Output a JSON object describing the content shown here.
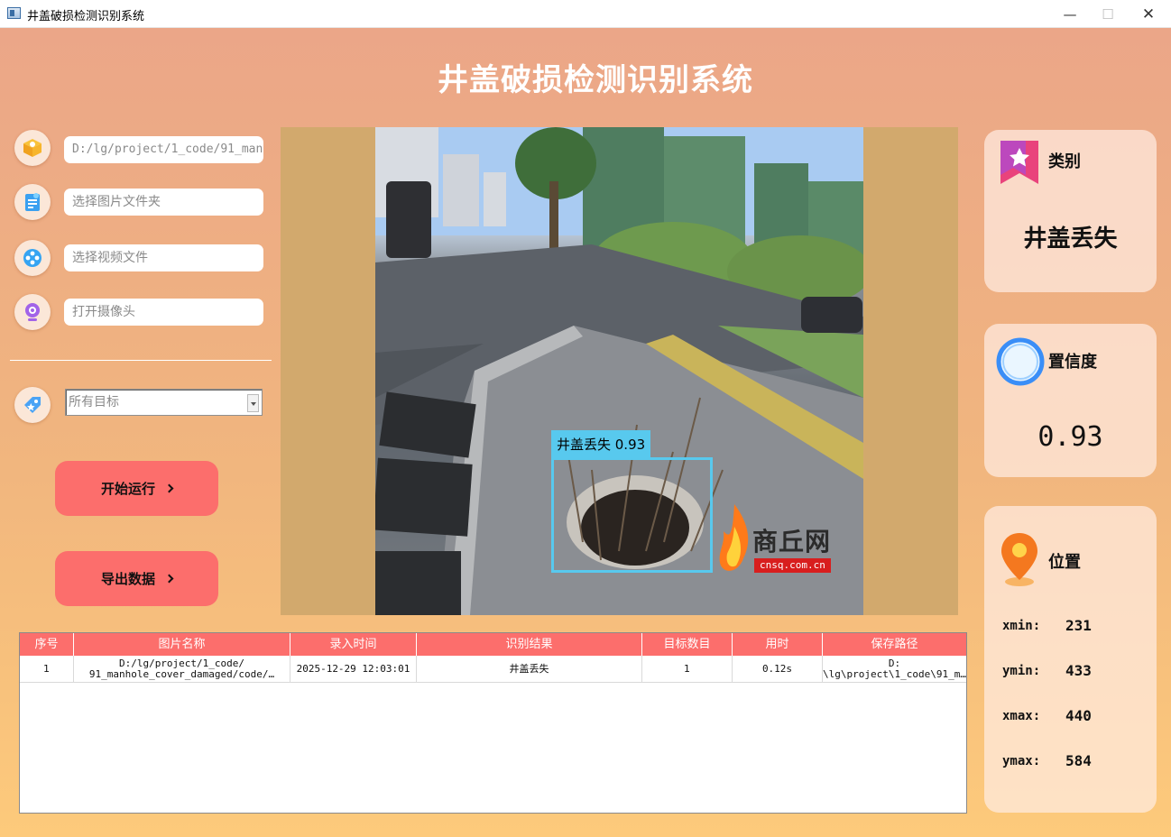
{
  "window": {
    "title": "井盖破损检测识别系统",
    "minimize_glyph": "—",
    "maximize_glyph": "☐",
    "close_glyph": "✕"
  },
  "app": {
    "title": "井盖破损检测识别系统"
  },
  "controls": {
    "image_path": "D:/lg/project/1_code/91_manhole_cover_damaged/code/",
    "folder_placeholder": "选择图片文件夹",
    "video_placeholder": "选择视频文件",
    "camera_placeholder": "打开摄像头",
    "target_select_value": "所有目标",
    "start_button": "开始运行",
    "export_button": "导出数据"
  },
  "icons": {
    "image": "image-file-icon",
    "folder": "folder-icon",
    "video": "video-icon",
    "camera": "webcam-icon",
    "target": "tag-icon"
  },
  "viewer": {
    "detection_label": "井盖丢失 0.93",
    "watermark_text": "商丘网",
    "watermark_url": "cnsq.com.cn"
  },
  "result": {
    "class_label": "类别",
    "class_value": "井盖丢失",
    "confidence_label": "置信度",
    "confidence_value": "0.93",
    "position_label": "位置",
    "xmin_label": "xmin:",
    "xmin": "231",
    "ymin_label": "ymin:",
    "ymin": "433",
    "xmax_label": "xmax:",
    "xmax": "440",
    "ymax_label": "ymax:",
    "ymax": "584"
  },
  "table": {
    "headers": [
      "序号",
      "图片名称",
      "录入时间",
      "识别结果",
      "目标数目",
      "用时",
      "保存路径"
    ],
    "rows": [
      {
        "index": "1",
        "name": "D:/lg/project/1_code/\n91_manhole_cover_damaged/code/…",
        "time": "2025-12-29 12:03:01",
        "result": "井盖丢失",
        "count": "1",
        "duration": "0.12s",
        "path": "D:\n\\lg\\project\\1_code\\91_m…"
      }
    ]
  },
  "colors": {
    "accent_button": "#fc6e6c",
    "detection_box": "#58c9ee",
    "viewer_bg": "#d2a96d"
  }
}
